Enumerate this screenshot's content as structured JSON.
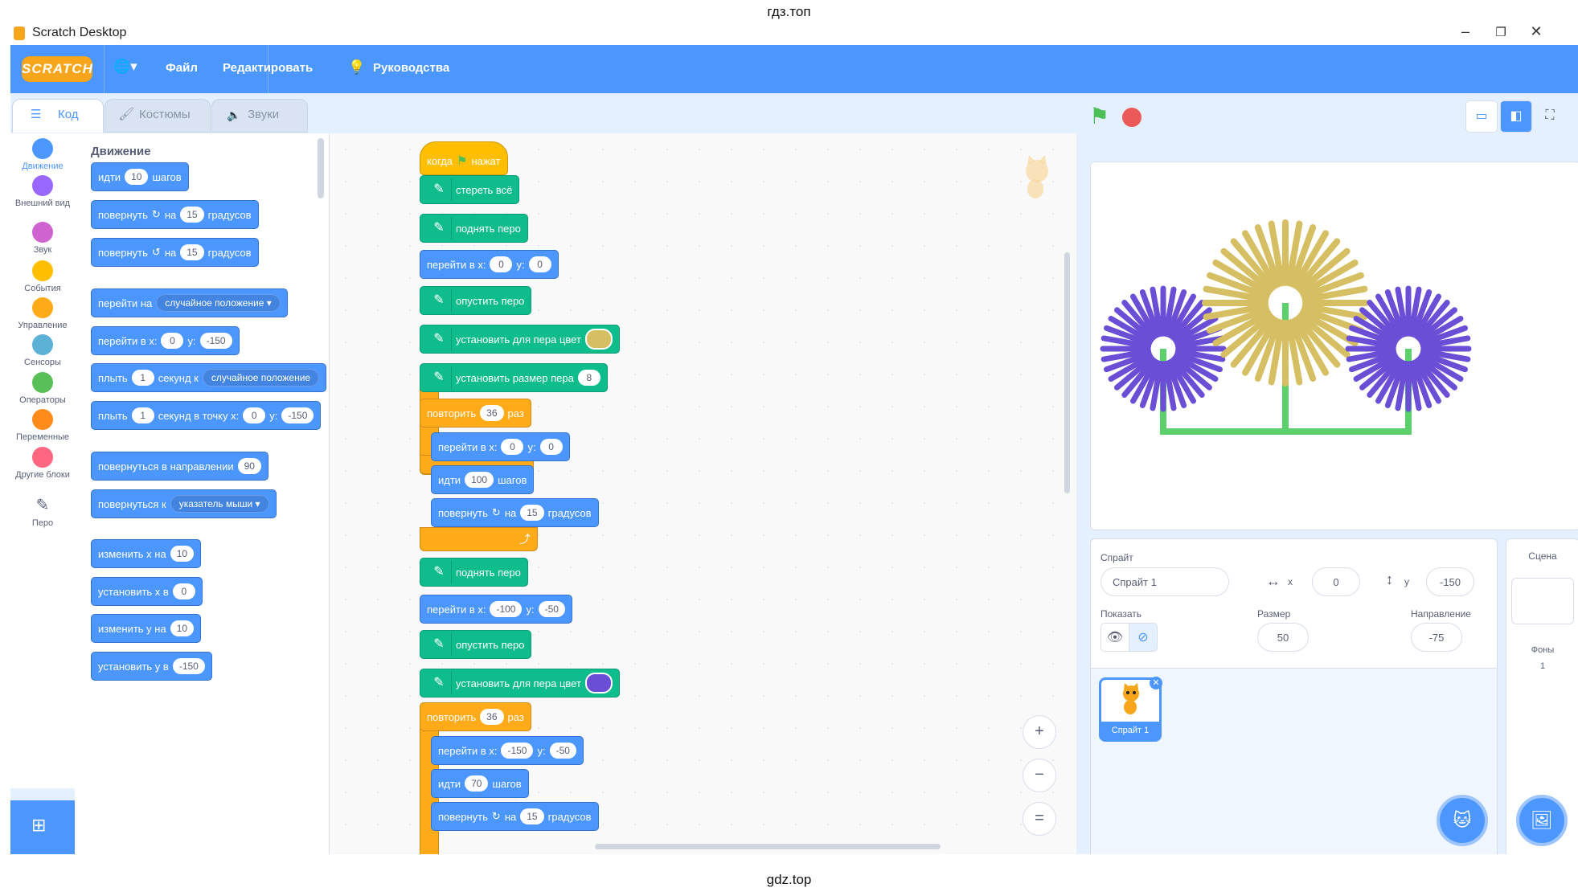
{
  "watermark": {
    "top": "гдз.топ",
    "bottom": "gdz.top"
  },
  "window": {
    "title": "Scratch Desktop",
    "min": "–",
    "restore": "❐",
    "close": "✕"
  },
  "menu": {
    "logo": "SCRATCH",
    "globe": "🌐▾",
    "file": "Файл",
    "edit": "Редактировать",
    "tutorials": "Руководства"
  },
  "tabs": {
    "code": "Код",
    "costumes": "Костюмы",
    "sounds": "Звуки"
  },
  "categories": [
    {
      "label": "Движение",
      "color": "#4c97ff"
    },
    {
      "label": "Внешний вид",
      "color": "#9966ff"
    },
    {
      "label": "Звук",
      "color": "#cf63cf"
    },
    {
      "label": "События",
      "color": "#ffbf00"
    },
    {
      "label": "Управление",
      "color": "#ffab19"
    },
    {
      "label": "Сенсоры",
      "color": "#5cb1d6"
    },
    {
      "label": "Операторы",
      "color": "#59c059"
    },
    {
      "label": "Переменные",
      "color": "#ff8c1a"
    },
    {
      "label": "Другие блоки",
      "color": "#ff6680"
    },
    {
      "label": "Перо",
      "color": "#0fbd8c"
    }
  ],
  "palette": {
    "title": "Движение",
    "b1": {
      "a": "идти",
      "v": "10",
      "b": "шагов"
    },
    "b2": {
      "a": "повернуть",
      "b": "на",
      "v": "15",
      "c": "градусов"
    },
    "b3": {
      "a": "повернуть",
      "b": "на",
      "v": "15",
      "c": "градусов"
    },
    "b4": {
      "a": "перейти на",
      "dd": "случайное положение ▾"
    },
    "b5": {
      "a": "перейти в x:",
      "x": "0",
      "b": "y:",
      "y": "-150"
    },
    "b6": {
      "a": "плыть",
      "v": "1",
      "b": "секунд к",
      "dd": "случайное положение"
    },
    "b7": {
      "a": "плыть",
      "v": "1",
      "b": "секунд в точку x:",
      "x": "0",
      "c": "y:",
      "y": "-150"
    },
    "b8": {
      "a": "повернуться в направлении",
      "v": "90"
    },
    "b9": {
      "a": "повернуться к",
      "dd": "указатель мыши ▾"
    },
    "b10": {
      "a": "изменить х на",
      "v": "10"
    },
    "b11": {
      "a": "установить х в",
      "v": "0"
    },
    "b12": {
      "a": "изменить у на",
      "v": "10"
    },
    "b13": {
      "a": "установить у в",
      "v": "-150"
    }
  },
  "script": {
    "hat": {
      "a": "когда",
      "b": "нажат"
    },
    "s1": "стереть всё",
    "s2": "поднять перо",
    "s3": {
      "a": "перейти в x:",
      "x": "0",
      "b": "y:",
      "y": "0"
    },
    "s4": "опустить перо",
    "s5": {
      "a": "установить для пера цвет",
      "color": "#d6bf63"
    },
    "s6": {
      "a": "установить размер пера",
      "v": "8"
    },
    "r1": {
      "a": "повторить",
      "v": "36",
      "b": "раз"
    },
    "r1a": {
      "a": "перейти в x:",
      "x": "0",
      "b": "y:",
      "y": "0"
    },
    "r1b": {
      "a": "идти",
      "v": "100",
      "b": "шагов"
    },
    "r1c": {
      "a": "повернуть",
      "b": "на",
      "v": "15",
      "c": "градусов"
    },
    "s7": "поднять перо",
    "s8": {
      "a": "перейти в x:",
      "x": "-100",
      "b": "y:",
      "y": "-50"
    },
    "s9": "опустить перо",
    "s10": {
      "a": "установить для пера цвет",
      "color": "#6a4fd6"
    },
    "r2": {
      "a": "повторить",
      "v": "36",
      "b": "раз"
    },
    "r2a": {
      "a": "перейти в x:",
      "x": "-150",
      "b": "y:",
      "y": "-50"
    },
    "r2b": {
      "a": "идти",
      "v": "70",
      "b": "шагов"
    },
    "r2c": {
      "a": "повернуть",
      "b": "на",
      "v": "15",
      "c": "градусов"
    }
  },
  "zoom": {
    "in": "+",
    "out": "−",
    "reset": "="
  },
  "sprite": {
    "label": "Спрайт",
    "name": "Спрайт 1",
    "x_label": "x",
    "x": "0",
    "y_label": "y",
    "y": "-150",
    "show_label": "Показать",
    "size_label": "Размер",
    "size": "50",
    "dir_label": "Направление",
    "dir": "-75",
    "thumb_label": "Спрайт 1"
  },
  "scene": {
    "label": "Сцена",
    "backdrops_label": "Фоны",
    "backdrops": "1"
  },
  "stage_drawing": {
    "flowers": [
      {
        "color": "#6a4fd6",
        "rays": 36
      },
      {
        "color": "#d6bf63",
        "rays": 36
      },
      {
        "color": "#6a4fd6",
        "rays": 36
      }
    ],
    "stem_color": "#5cd16b"
  }
}
